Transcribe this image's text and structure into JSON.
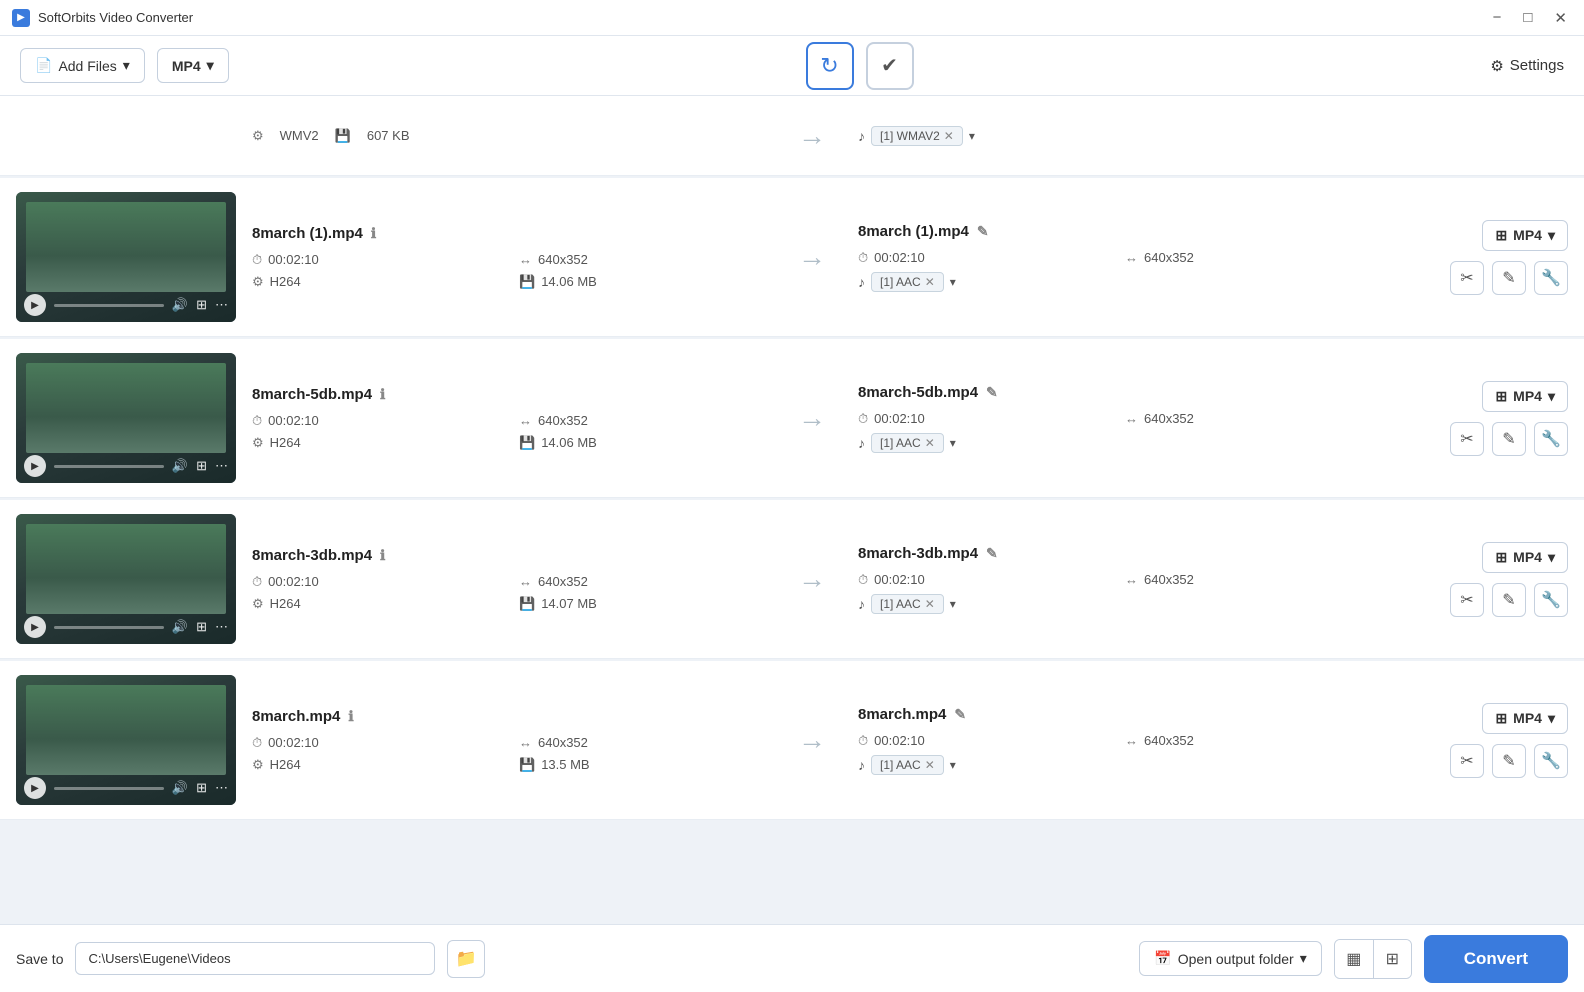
{
  "titleBar": {
    "icon": "▶",
    "title": "SoftOrbits Video Converter",
    "minimize": "−",
    "maximize": "□",
    "close": "✕"
  },
  "toolbar": {
    "addFiles": "Add Files",
    "format": "MP4",
    "settings": "Settings"
  },
  "partialRow": {
    "format": "WMV2",
    "size": "607 KB",
    "audioLabel": "[1] WMAV2"
  },
  "files": [
    {
      "name": "8march (1).mp4",
      "duration": "00:02:10",
      "resolution": "640x352",
      "codec": "H264",
      "size": "14.06 MB",
      "output": {
        "name": "8march (1).mp4",
        "duration": "00:02:10",
        "resolution": "640x352",
        "audioLabel": "[1] AAC",
        "format": "MP4"
      }
    },
    {
      "name": "8march-5db.mp4",
      "duration": "00:02:10",
      "resolution": "640x352",
      "codec": "H264",
      "size": "14.06 MB",
      "output": {
        "name": "8march-5db.mp4",
        "duration": "00:02:10",
        "resolution": "640x352",
        "audioLabel": "[1] AAC",
        "format": "MP4"
      }
    },
    {
      "name": "8march-3db.mp4",
      "duration": "00:02:10",
      "resolution": "640x352",
      "codec": "H264",
      "size": "14.07 MB",
      "output": {
        "name": "8march-3db.mp4",
        "duration": "00:02:10",
        "resolution": "640x352",
        "audioLabel": "[1] AAC",
        "format": "MP4"
      }
    },
    {
      "name": "8march.mp4",
      "duration": "00:02:10",
      "resolution": "640x352",
      "codec": "H264",
      "size": "13.5 MB",
      "output": {
        "name": "8march.mp4",
        "duration": "00:02:10",
        "resolution": "640x352",
        "audioLabel": "[1] AAC",
        "format": "MP4"
      }
    }
  ],
  "bottomBar": {
    "saveToLabel": "Save to",
    "savePath": "C:\\Users\\Eugene\\Videos",
    "openOutputFolder": "Open output folder",
    "convertLabel": "Convert"
  }
}
